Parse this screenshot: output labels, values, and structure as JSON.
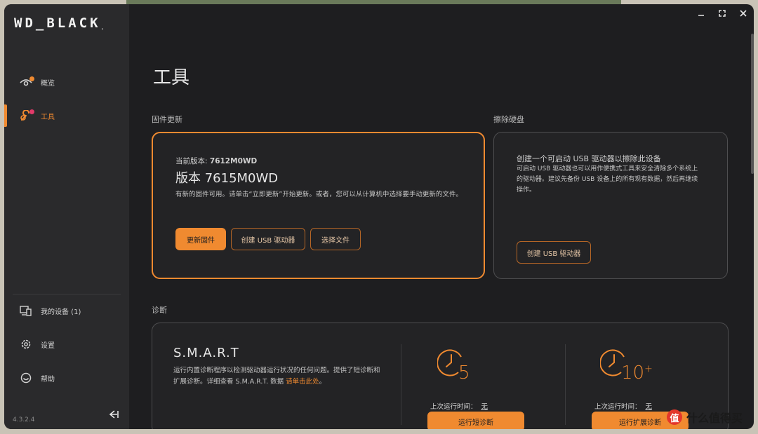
{
  "app": {
    "logo_text": "WD_BLACK",
    "version": "4.3.2.4"
  },
  "colors": {
    "accent": "#f08a30",
    "background": "#1e1e20",
    "sidebar": "#2a2a2c"
  },
  "sidebar": {
    "items": [
      {
        "label": "概览",
        "icon": "eye-icon",
        "active": false
      },
      {
        "label": "工具",
        "icon": "wrench-icon",
        "active": true
      }
    ],
    "bottom_items": [
      {
        "label": "我的设备 (1)",
        "icon": "devices-icon"
      },
      {
        "label": "设置",
        "icon": "gear-icon"
      },
      {
        "label": "帮助",
        "icon": "help-icon"
      }
    ]
  },
  "page": {
    "title": "工具"
  },
  "firmware": {
    "section_label": "固件更新",
    "current_version_prefix": "当前版本:",
    "current_version": "7612M0WD",
    "new_version": "版本 7615M0WD",
    "description": "有新的固件可用。请单击“立即更新”开始更新。或者，您可以从计算机中选择要手动更新的文件。",
    "buttons": {
      "update": "更新固件",
      "create_usb": "创建 USB 驱动器",
      "choose_file": "选择文件"
    }
  },
  "erase": {
    "section_label": "擦除硬盘",
    "heading": "创建一个可启动 USB 驱动器以擦除此设备",
    "description": "可启动 USB 驱动器也可以用作便携式工具来安全清除多个系统上的驱动器。建议先备份 USB 设备上的所有现有数据，然后再继续操作。",
    "button": "创建 USB 驱动器"
  },
  "diagnostics": {
    "section_label": "诊断",
    "title": "S.M.A.R.T",
    "description_main": "运行内置诊断程序以检测驱动器运行状况的任何问题。提供了短诊断和扩展诊断。详细查看 S.M.A.R.T. 数据 ",
    "description_link": "请单击此处",
    "description_end": "。",
    "short": {
      "minutes": "5",
      "last_run_label": "上次运行时间：",
      "last_run_value": "无",
      "button": "运行短诊断"
    },
    "extended": {
      "minutes": "10",
      "minutes_suffix": "+",
      "last_run_label": "上次运行时间：",
      "last_run_value": "无",
      "button": "运行扩展诊断"
    }
  },
  "watermark": {
    "text": "什么值得买",
    "logo_char": "值"
  }
}
